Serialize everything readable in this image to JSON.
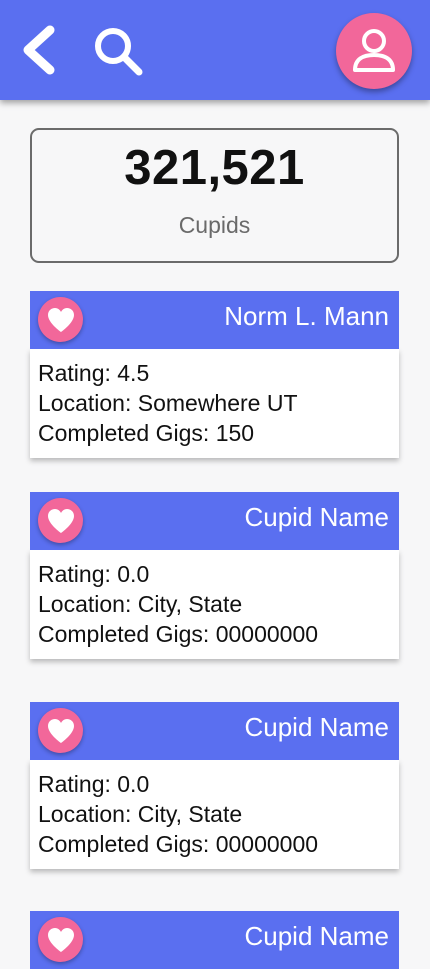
{
  "header": {
    "back_icon": "chevron-left-icon",
    "search_icon": "search-icon",
    "profile_icon": "user-icon"
  },
  "stats": {
    "count": "321,521",
    "label": "Cupids"
  },
  "cupids": [
    {
      "name": "Norm L. Mann",
      "rating": "Rating: 4.5",
      "location": "Location: Somewhere UT",
      "gigs": "Completed Gigs: 150"
    },
    {
      "name": "Cupid Name",
      "rating": "Rating: 0.0",
      "location": "Location: City, State",
      "gigs": "Completed Gigs: 00000000"
    },
    {
      "name": "Cupid Name",
      "rating": "Rating: 0.0",
      "location": "Location: City, State",
      "gigs": "Completed Gigs: 00000000"
    },
    {
      "name": "Cupid Name"
    }
  ],
  "colors": {
    "header": "#5a6ff0",
    "accent_pink": "#f2679a",
    "card_body": "#ffffff",
    "background": "#f7f7f8"
  }
}
